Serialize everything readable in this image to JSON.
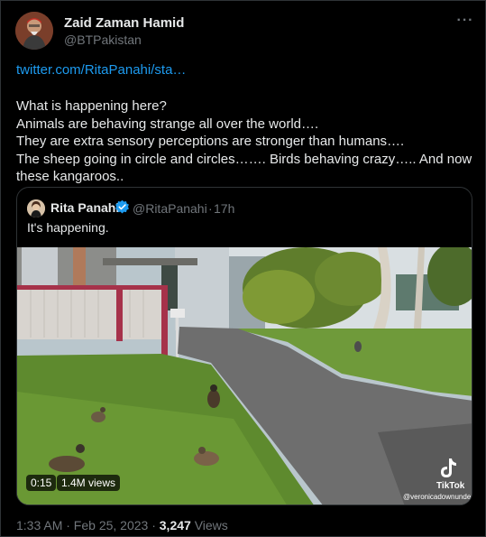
{
  "tweet": {
    "author": {
      "display_name": "Zaid Zaman Hamid",
      "handle": "@BTPakistan"
    },
    "more_icon": "more-horizontal-icon",
    "link_text": "twitter.com/RitaPanahi/sta…",
    "text_lines": [
      "What is happening here?",
      "Animals are behaving strange all over the world….",
      "They are extra sensory perceptions are stronger than humans….",
      "The sheep going in circle and circles……. Birds behaving crazy….. And now",
      "these kangaroos.."
    ],
    "timestamp": "1:33 AM · Feb 25, 2023 · ",
    "views_count": "3,247",
    "views_label": " Views"
  },
  "quote": {
    "author": {
      "display_name": "Rita Panahi",
      "handle": "@RitaPanahi",
      "separator": "·",
      "time": "17h"
    },
    "verified_icon": "verified-badge-icon",
    "verified_color": "#1d9bf0",
    "text": "It's happening.",
    "video": {
      "elapsed": "0:15",
      "views": "1.4M views",
      "watermark_label": "TikTok",
      "watermark_user": "@veronicadownunder"
    }
  },
  "colors": {
    "background": "#000000",
    "text": "#e7e9ea",
    "secondary": "#71767b",
    "link": "#1d9bf0",
    "border": "#2f3336"
  }
}
